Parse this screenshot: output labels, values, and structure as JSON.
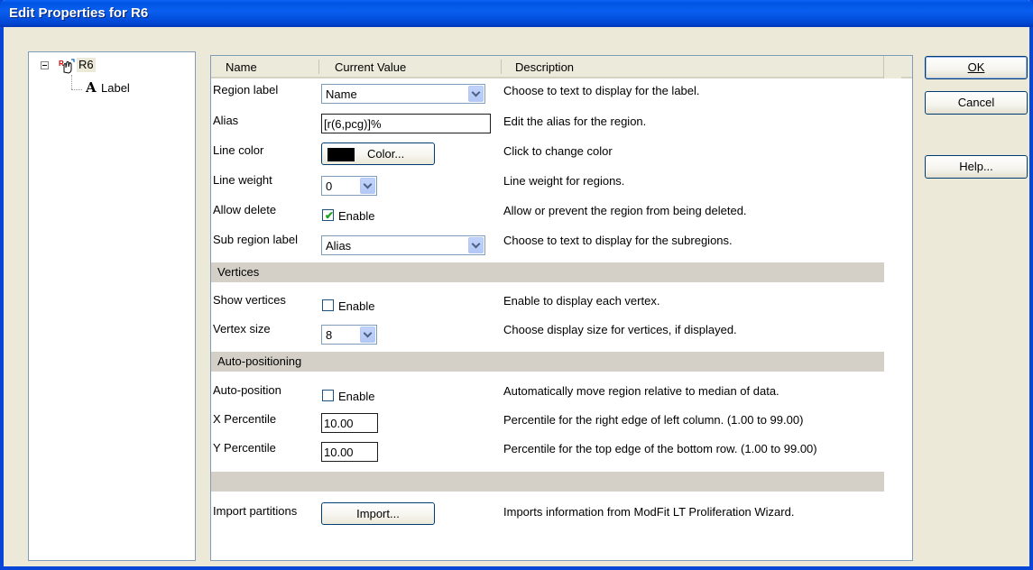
{
  "window": {
    "title": "Edit Properties for R6"
  },
  "tree": {
    "root_label": "R6",
    "child_label": "Label"
  },
  "grid": {
    "headers": {
      "name": "Name",
      "value": "Current Value",
      "description": "Description"
    },
    "rows": {
      "region_label": {
        "name": "Region label",
        "value": "Name",
        "description": "Choose to text to display for the label."
      },
      "alias": {
        "name": "Alias",
        "value": "[r(6,pcg)]%",
        "description": "Edit the alias for the region."
      },
      "line_color": {
        "name": "Line color",
        "value": "Color...",
        "description": "Click to change color",
        "swatch": "#000000"
      },
      "line_weight": {
        "name": "Line weight",
        "value": "0",
        "description": "Line weight for regions."
      },
      "allow_delete": {
        "name": "Allow delete",
        "value": "Enable",
        "checked": true,
        "description": "Allow or prevent the region from being deleted."
      },
      "sub_region_label": {
        "name": "Sub region label",
        "value": "Alias",
        "description": "Choose to text to display for the subregions."
      },
      "show_vertices": {
        "name": "Show vertices",
        "value": "Enable",
        "checked": false,
        "description": "Enable to display each vertex."
      },
      "vertex_size": {
        "name": "Vertex size",
        "value": "8",
        "description": "Choose display size for vertices, if displayed."
      },
      "auto_position": {
        "name": "Auto-position",
        "value": "Enable",
        "checked": false,
        "description": "Automatically move region relative to median of data."
      },
      "x_percentile": {
        "name": "X Percentile",
        "value": "10.00",
        "description": "Percentile for the right edge of left column. (1.00 to 99.00)"
      },
      "y_percentile": {
        "name": "Y Percentile",
        "value": "10.00",
        "description": "Percentile for the top edge of the bottom row. (1.00 to 99.00)"
      },
      "import_partitions": {
        "name": "Import partitions",
        "value": "Import...",
        "description": "Imports information from ModFit LT Proliferation Wizard."
      }
    },
    "sections": {
      "vertices": "Vertices",
      "auto_positioning": "Auto-positioning"
    }
  },
  "buttons": {
    "ok": "OK",
    "cancel": "Cancel",
    "help": "Help..."
  },
  "icons": {
    "tree_root": "region-icon",
    "tree_child": "text-label-icon",
    "check": "checkmark-icon"
  }
}
